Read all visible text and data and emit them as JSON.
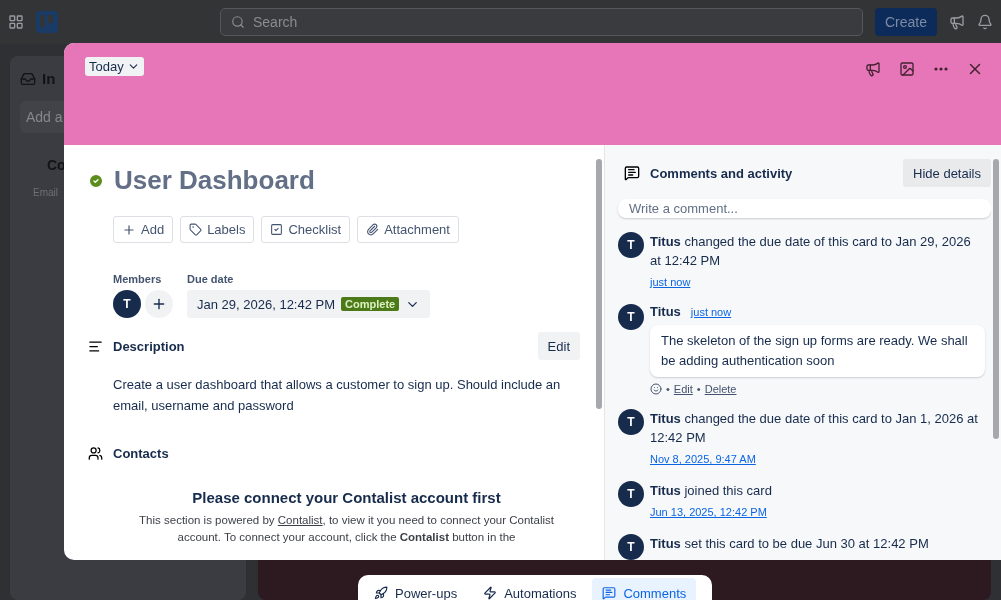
{
  "topbar": {
    "search_placeholder": "Search",
    "create_button": "Create"
  },
  "background": {
    "inbox_title": "In",
    "add_field": "Add a",
    "panel_heading": "Co",
    "panel_text": "Email"
  },
  "bottom_nav": [
    {
      "label": "Power-ups",
      "kind": "powerups",
      "selected": false
    },
    {
      "label": "Automations",
      "kind": "automations",
      "selected": false
    },
    {
      "label": "Comments",
      "kind": "comments",
      "selected": true
    }
  ],
  "card": {
    "list_button": "Today",
    "title": "User Dashboard",
    "complete": true,
    "actions": [
      {
        "label": "Add",
        "kind": "add"
      },
      {
        "label": "Labels",
        "kind": "labels"
      },
      {
        "label": "Checklist",
        "kind": "checklist"
      },
      {
        "label": "Attachment",
        "kind": "attachment"
      }
    ],
    "members_label": "Members",
    "member_initial": "T",
    "due_label": "Due date",
    "due_value": "Jan 29, 2026, 12:42 PM",
    "due_status": "Complete",
    "description": {
      "heading": "Description",
      "edit_button": "Edit",
      "text": "Create a user dashboard that allows a customer to sign up. Should include an email, username and password"
    },
    "contacts": {
      "heading": "Contacts",
      "notice_title": "Please connect your Contalist account first",
      "notice_before": "This section is powered by",
      "notice_link": "Contalist",
      "notice_after": ", to view it you need to connect your Contalist account. To connect your account, click the **Contalist** button in the"
    }
  },
  "activity": {
    "heading": "Comments and activity",
    "hide_button": "Hide details",
    "comment_placeholder": "Write a comment...",
    "items": [
      {
        "kind": "event",
        "initial": "T",
        "text": "**Titus** changed the due date of this card to Jan 29, 2026 at 12:42 PM",
        "time": "just now"
      },
      {
        "kind": "comment",
        "initial": "T",
        "author": "Titus",
        "time": "just now",
        "body": "The skeleton of the sign up forms are ready. We shall be adding authentication soon",
        "actions": [
          "Edit",
          "Delete"
        ],
        "separator": "•"
      },
      {
        "kind": "event",
        "initial": "T",
        "text": "**Titus** changed the due date of this card to Jan 1, 2026 at 12:42 PM",
        "time": "Nov 8, 2025, 9:47 AM"
      },
      {
        "kind": "event",
        "initial": "T",
        "text": "**Titus** joined this card",
        "time": "Jun 13, 2025, 12:42 PM"
      },
      {
        "kind": "event",
        "initial": "T",
        "text": "**Titus** set this card to be due Jun 30 at 12:42 PM"
      }
    ]
  }
}
